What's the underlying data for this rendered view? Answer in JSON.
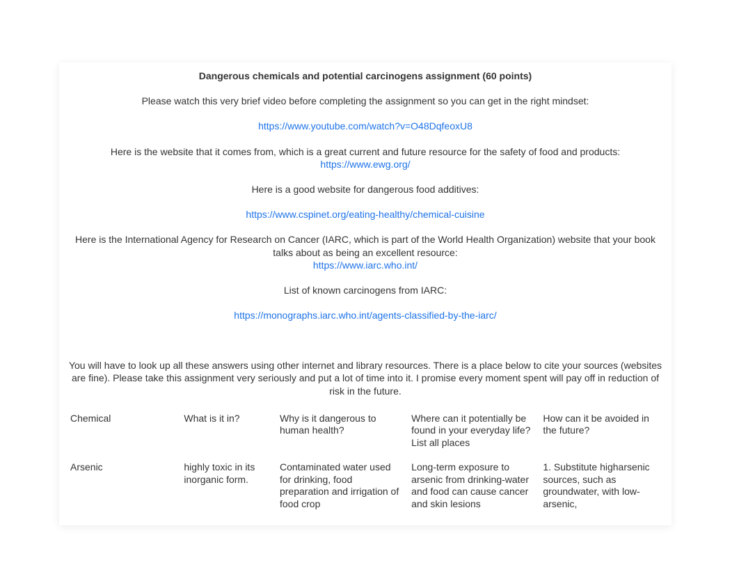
{
  "title": "Dangerous chemicals and potential carcinogens assignment (60 points)",
  "intro1": "Please watch this very brief video before completing the assignment so you can get in the right mindset: ",
  "link1": "https://www.youtube.com/watch?v=O48DqfeoxU8",
  "intro2": "Here is the website that it comes from, which is a great current and future resource for the safety of food and products: ",
  "link2": "https://www.ewg.org/",
  "intro3": "Here is a good website for dangerous food additives: ",
  "link3": "https://www.cspinet.org/eating-healthy/chemical-cuisine",
  "intro4": "Here is the International Agency for Research on Cancer (IARC, which is part of the World Health Organization) website that your book talks about as being an excellent resource:",
  "link4": " https://www.iarc.who.int/",
  "intro5": "List of known carcinogens from IARC: ",
  "link5": "https://monographs.iarc.who.int/agents-classified-by-the-iarc/",
  "instructions": "You will have to look up all these answers using other internet and library resources.  There is a place below to cite your sources (websites are fine).  Please take this assignment very seriously and put a lot of time into it.  I promise every moment spent will pay off in reduction of risk in the future. ",
  "table": {
    "headers": {
      "c1": "Chemical",
      "c2": "What is it in?",
      "c3": "Why is it dangerous to human health?",
      "c4": "Where can it potentially be found in your everyday life?  List all places",
      "c5": "How can it be avoided in the future?"
    },
    "row1": {
      "c1": "Arsenic",
      "c2": "highly toxic in its inorganic form.",
      "c3": "Contaminated water used for drinking, food preparation and irrigation of food crop",
      "c4": "Long-term exposure to arsenic from drinking-water and food can cause cancer and skin lesions",
      "c5": "1. Substitute higharsenic sources, such as groundwater, with low-arsenic,"
    }
  }
}
